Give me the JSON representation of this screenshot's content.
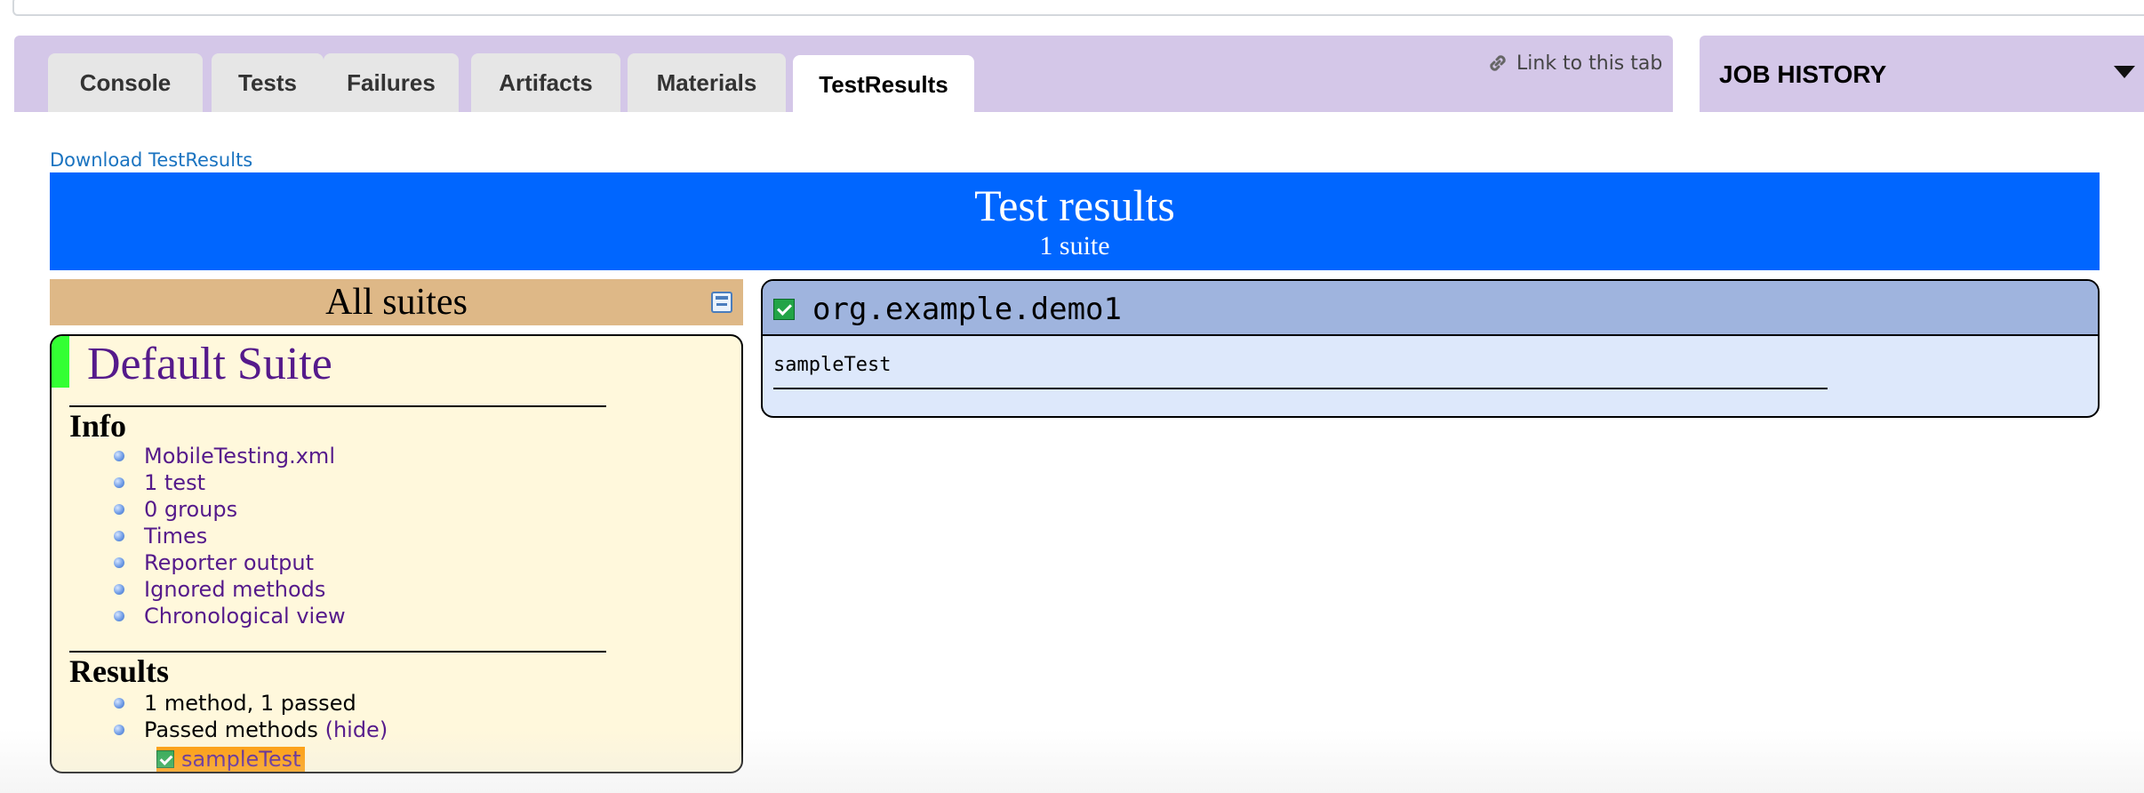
{
  "tabs": [
    {
      "label": "Console"
    },
    {
      "label": "Tests"
    },
    {
      "label": "Failures"
    },
    {
      "label": "Artifacts"
    },
    {
      "label": "Materials"
    },
    {
      "label": "TestResults",
      "active": true
    }
  ],
  "link_tab": "Link to this tab",
  "job_history": "JOB HISTORY",
  "download_link": "Download TestResults",
  "banner": {
    "title": "Test results",
    "subtitle": "1 suite"
  },
  "all_suites": "All suites",
  "suite": {
    "name": "Default Suite",
    "info_heading": "Info",
    "info_items": [
      "MobileTesting.xml",
      "1 test",
      "0 groups",
      "Times",
      "Reporter output",
      "Ignored methods",
      "Chronological view"
    ],
    "results_heading": "Results",
    "results_summary": "1 method, 1 passed",
    "passed_methods_label": "Passed methods",
    "hide_label": "(hide)",
    "passed_method": "sampleTest"
  },
  "class_panel": {
    "name": "org.example.demo1",
    "method": "sampleTest"
  },
  "colors": {
    "tab_bar": "#d4c7e8",
    "banner": "#0066ff",
    "suite_header": "#deb887",
    "suite_box": "#fff8dc",
    "pass_accent": "#33ff33",
    "link": "#551a8b",
    "passed_highlight": "#ff9900",
    "class_header": "#9fb4de",
    "class_body": "#dde8fb"
  },
  "icons": {
    "link_tab": "link-icon",
    "collapse": "collapse-icon",
    "job_history": "chevron-down-icon",
    "passed": "checkbox-checked-icon"
  }
}
